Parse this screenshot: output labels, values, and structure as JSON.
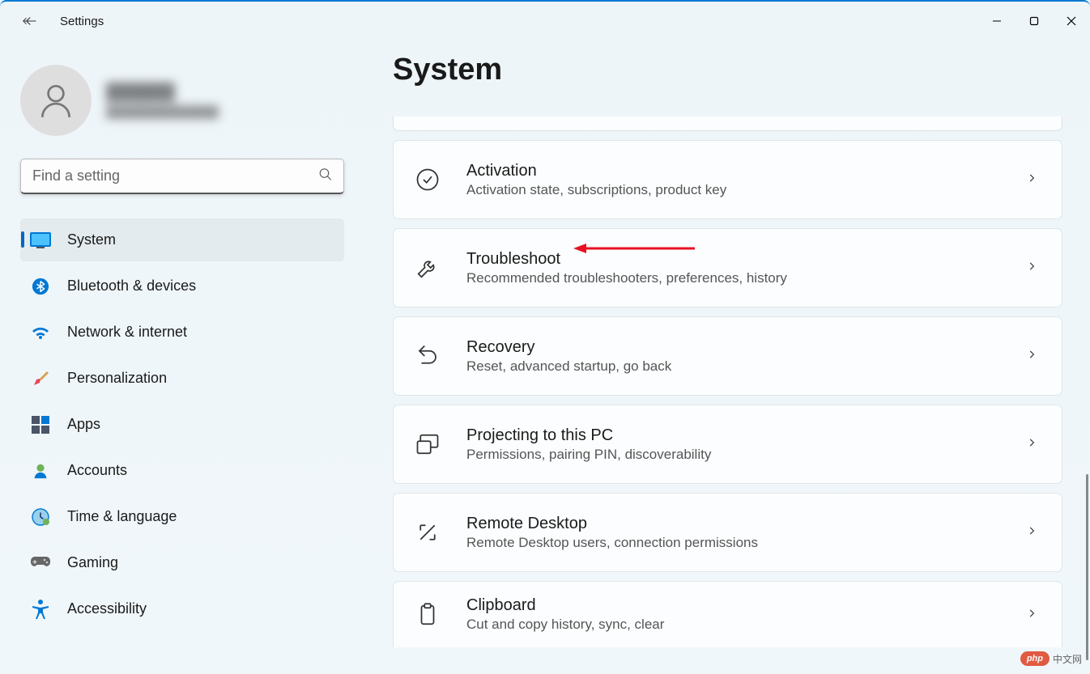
{
  "app_title": "Settings",
  "search": {
    "placeholder": "Find a setting"
  },
  "user": {
    "name": "██████",
    "email": "██████████████"
  },
  "sidebar": {
    "items": [
      {
        "id": "system",
        "label": "System",
        "icon": "display-icon",
        "active": true
      },
      {
        "id": "bluetooth",
        "label": "Bluetooth & devices",
        "icon": "bluetooth-icon",
        "active": false
      },
      {
        "id": "network",
        "label": "Network & internet",
        "icon": "wifi-icon",
        "active": false
      },
      {
        "id": "personalization",
        "label": "Personalization",
        "icon": "brush-icon",
        "active": false
      },
      {
        "id": "apps",
        "label": "Apps",
        "icon": "apps-icon",
        "active": false
      },
      {
        "id": "accounts",
        "label": "Accounts",
        "icon": "person-icon",
        "active": false
      },
      {
        "id": "time",
        "label": "Time & language",
        "icon": "clock-icon",
        "active": false
      },
      {
        "id": "gaming",
        "label": "Gaming",
        "icon": "gamepad-icon",
        "active": false
      },
      {
        "id": "accessibility",
        "label": "Accessibility",
        "icon": "accessibility-icon",
        "active": false
      }
    ]
  },
  "page": {
    "title": "System"
  },
  "settings": [
    {
      "id": "activation",
      "title": "Activation",
      "desc": "Activation state, subscriptions, product key",
      "icon": "check-circle-icon"
    },
    {
      "id": "troubleshoot",
      "title": "Troubleshoot",
      "desc": "Recommended troubleshooters, preferences, history",
      "icon": "wrench-icon"
    },
    {
      "id": "recovery",
      "title": "Recovery",
      "desc": "Reset, advanced startup, go back",
      "icon": "recovery-icon"
    },
    {
      "id": "projecting",
      "title": "Projecting to this PC",
      "desc": "Permissions, pairing PIN, discoverability",
      "icon": "project-icon"
    },
    {
      "id": "remote",
      "title": "Remote Desktop",
      "desc": "Remote Desktop users, connection permissions",
      "icon": "remote-icon"
    },
    {
      "id": "clipboard",
      "title": "Clipboard",
      "desc": "Cut and copy history, sync, clear",
      "icon": "clipboard-icon"
    }
  ],
  "watermark": {
    "pill": "php",
    "text": "中文网"
  }
}
